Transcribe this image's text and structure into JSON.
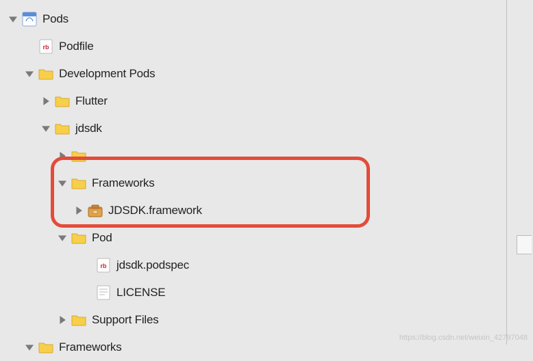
{
  "tree": {
    "root": {
      "label": "Pods"
    },
    "podfile": {
      "label": "Podfile"
    },
    "devpods": {
      "label": "Development Pods"
    },
    "flutter": {
      "label": "Flutter"
    },
    "jdsdk": {
      "label": "jdsdk"
    },
    "dotdot": {
      "label": ".."
    },
    "frameworks_inner": {
      "label": "Frameworks"
    },
    "jdsdk_framework": {
      "label": "JDSDK.framework"
    },
    "pod": {
      "label": "Pod"
    },
    "podspec": {
      "label": "jdsdk.podspec"
    },
    "license": {
      "label": "LICENSE"
    },
    "support": {
      "label": "Support Files"
    },
    "frameworks_outer": {
      "label": "Frameworks"
    }
  },
  "watermark": "https://blog.csdn.net/weixin_42797048"
}
